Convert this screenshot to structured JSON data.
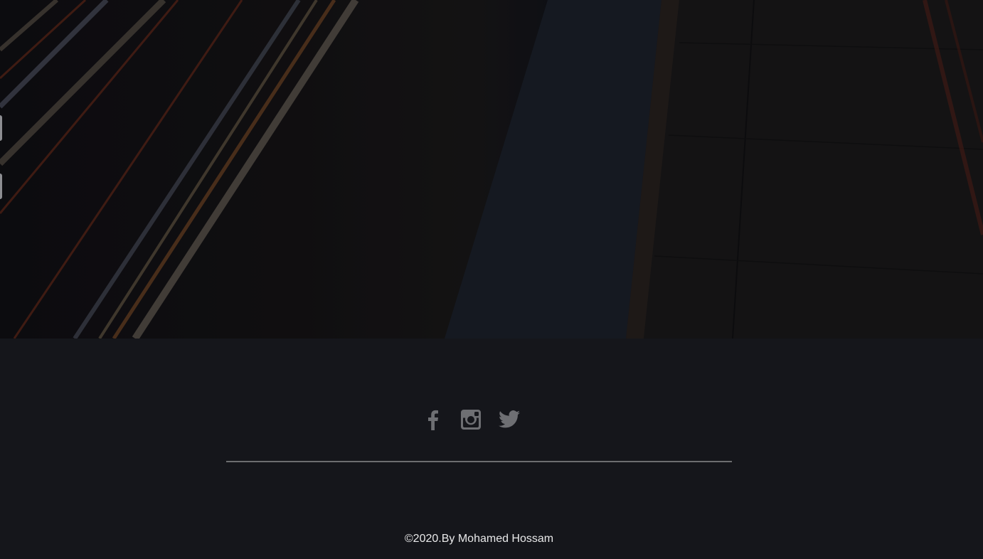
{
  "hero": {
    "image": "road-light-trails-background"
  },
  "footer": {
    "social": [
      {
        "name": "facebook-icon"
      },
      {
        "name": "instagram-icon"
      },
      {
        "name": "twitter-icon"
      }
    ],
    "copyright": "©2020.By Mohamed Hossam"
  },
  "colors": {
    "footer_background": "#15161b",
    "icon_color": "#6e6f73",
    "divider_color": "#6c6d70",
    "text_color": "#e9e9ea"
  }
}
